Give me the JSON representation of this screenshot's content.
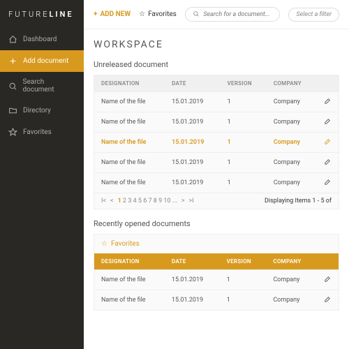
{
  "brand": {
    "a": "FUTURE",
    "b": "LINE"
  },
  "nav": [
    {
      "label": "Dashboard"
    },
    {
      "label": "Add document"
    },
    {
      "label": "Search document"
    },
    {
      "label": "Directory"
    },
    {
      "label": "Favorites"
    }
  ],
  "topbar": {
    "addnew": "ADD NEW",
    "favorites": "Favorites",
    "search_ph": "Search for a document...",
    "filter": "Select a filter"
  },
  "page_title": "WORKSPACE",
  "section1": {
    "title": "Unreleased document",
    "cols": {
      "designation": "DESIGNATION",
      "date": "DATE",
      "version": "VERSION",
      "company": "COMPANY"
    },
    "rows": [
      {
        "name": "Name of the file",
        "date": "15.01.2019",
        "ver": "1",
        "co": "Company"
      },
      {
        "name": "Name of the file",
        "date": "15.01.2019",
        "ver": "1",
        "co": "Company"
      },
      {
        "name": "Name of the file",
        "date": "15.01.2019",
        "ver": "1",
        "co": "Company"
      },
      {
        "name": "Name of the file",
        "date": "15.01.2019",
        "ver": "1",
        "co": "Company"
      },
      {
        "name": "Name of the file",
        "date": "15.01.2019",
        "ver": "1",
        "co": "Company"
      }
    ],
    "pager": {
      "pages": [
        "1",
        "2",
        "3",
        "4",
        "5",
        "6",
        "7",
        "8",
        "9",
        "10",
        "..."
      ],
      "status": "Displaying Items 1 - 5 of"
    }
  },
  "section2": {
    "title": "Recently opened documents",
    "fav": "Favorites",
    "cols": {
      "designation": "DESIGNATION",
      "date": "DATE",
      "version": "VERSION",
      "company": "COMPANY"
    },
    "rows": [
      {
        "name": "Name of the file",
        "date": "15.01.2019",
        "ver": "1",
        "co": "Company"
      },
      {
        "name": "Name of the file",
        "date": "15.01.2019",
        "ver": "1",
        "co": "Company"
      }
    ]
  }
}
